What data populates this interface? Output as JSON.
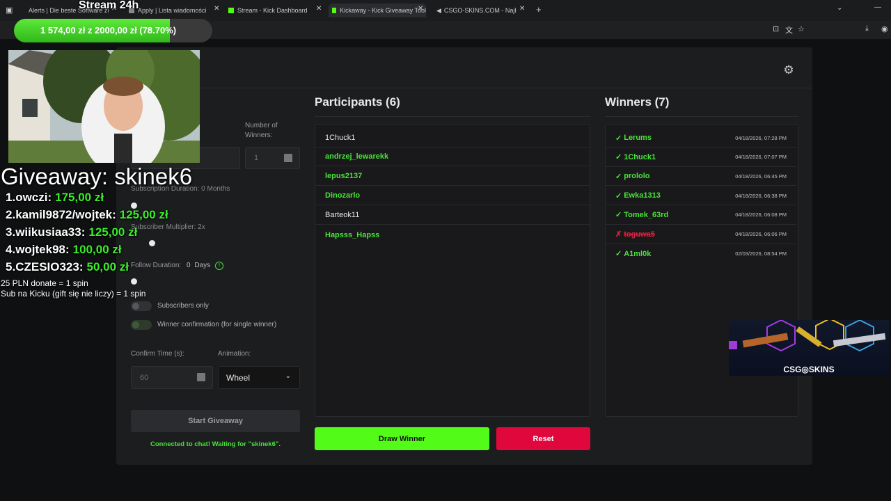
{
  "browser": {
    "tabs": [
      {
        "label": "Alerts | Die beste Software zur"
      },
      {
        "label": "Apply | Lista wiadomości"
      },
      {
        "label": "Stream - Kick Dashboard"
      },
      {
        "label": "Kickaway - Kick Giveaway Tool"
      },
      {
        "label": "CSGO-SKINS.COM - Najlep"
      }
    ],
    "new_tab": "+"
  },
  "app": {
    "participants_title": "Participants (6)",
    "winners_title": "Winners (7)",
    "participants": [
      "1Chuck1",
      "andrzej_lewarekk",
      "lepus2137",
      "Dinozarlo",
      "Barteok11",
      "Hapsss_Hapss"
    ],
    "participant_highlight": [
      false,
      true,
      true,
      true,
      false,
      true
    ],
    "winners": [
      {
        "name": "Lerums",
        "date": "04/18/2026, 07:28 PM",
        "mark": "✓",
        "status": "confirmed"
      },
      {
        "name": "1Chuck1",
        "date": "04/18/2026, 07:07 PM",
        "mark": "✓",
        "status": "confirmed"
      },
      {
        "name": "prololo",
        "date": "04/18/2026, 06:45 PM",
        "mark": "✓",
        "status": "confirmed"
      },
      {
        "name": "Ewka1313",
        "date": "04/18/2026, 06:38 PM",
        "mark": "✓",
        "status": "confirmed"
      },
      {
        "name": "Tomek_63rd",
        "date": "04/18/2026, 06:08 PM",
        "mark": "✓",
        "status": "confirmed"
      },
      {
        "name": "toguwa5",
        "date": "04/18/2026, 06:06 PM",
        "mark": "✗",
        "status": "rejected"
      },
      {
        "name": "A1ml0k",
        "date": "02/03/2026, 08:54 PM",
        "mark": "✓",
        "status": "confirmed"
      }
    ],
    "form": {
      "number_of_winners_label": "Number of\nWinners:",
      "number_of_winners": "1",
      "subscription_duration": "Subscription Duration: 0 Months",
      "subscriber_multiplier": "Subscriber Multiplier: 2x",
      "follow_duration_label": "Follow Duration:",
      "follow_duration_value": "0",
      "follow_duration_unit": "Days",
      "subscribers_only": "Subscribers only",
      "winner_confirmation": "Winner confirmation (for single winner)",
      "confirm_time_label": "Confirm Time (s):",
      "confirm_time_placeholder": "60",
      "animation_label": "Animation:",
      "animation_value": "Wheel",
      "start_button": "Start Giveaway",
      "status": "Connected to chat! Waiting for \"skinek6\"."
    },
    "draw_button": "Draw Winner",
    "reset_button": "Reset"
  },
  "overlay": {
    "stream_title": "Stream 24h",
    "goal_text": "1 574,00 zł z 2000,00 zł (78.70%)",
    "goal_progress": 0.787,
    "giveaway_title": "Giveaway: skinek6",
    "leaderboard": [
      {
        "rank": "1.",
        "name": "owczi:",
        "amount": "175,00 zł"
      },
      {
        "rank": "2.",
        "name": "kamil9872/wojtek:",
        "amount": "125,00 zł"
      },
      {
        "rank": "3.",
        "name": "wiikusiaa33:",
        "amount": "125,00 zł"
      },
      {
        "rank": "4.",
        "name": "wojtek98:",
        "amount": "100,00 zł"
      },
      {
        "rank": "5.",
        "name": "CZESIO323:",
        "amount": "50,00 zł"
      }
    ],
    "rule1": "25 PLN donate = 1 spin",
    "rule2": "Sub na Kicku (gift się nie liczy) = 1 spin",
    "ad_logo": "CSG◎SKINS"
  },
  "colors": {
    "accent_green": "#53fc18",
    "reset_red": "#e0073c"
  }
}
